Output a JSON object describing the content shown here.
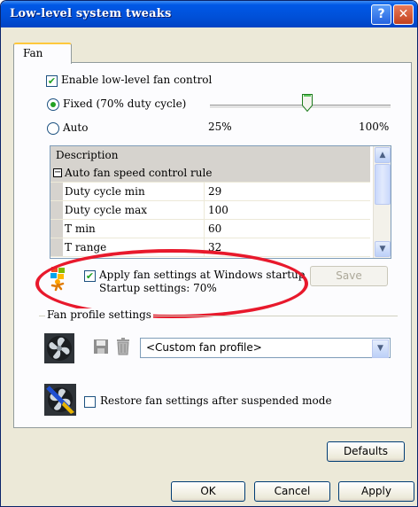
{
  "window": {
    "title": "Low-level system tweaks",
    "help_glyph": "?",
    "close_glyph": "✕"
  },
  "tabs": [
    {
      "label": "Fan",
      "selected": true
    }
  ],
  "fan_control": {
    "enable_label": "Enable low-level fan control",
    "enable_checked": true,
    "fixed_label": "Fixed (70% duty cycle)",
    "fixed_selected": true,
    "auto_label": "Auto",
    "auto_selected": false,
    "slider_min_label": "25%",
    "slider_max_label": "100%",
    "slider_value_percent": 70
  },
  "property_grid": {
    "header": "Description",
    "category": "Auto fan speed control rule",
    "collapse_glyph": "−",
    "rows": [
      {
        "name": "Duty cycle min",
        "value": "29"
      },
      {
        "name": "Duty cycle max",
        "value": "100"
      },
      {
        "name": "T min",
        "value": "60"
      },
      {
        "name": "T range",
        "value": "32"
      }
    ],
    "scroll_up_glyph": "▲",
    "scroll_down_glyph": "▼"
  },
  "startup": {
    "apply_label": "Apply fan settings at Windows startup",
    "apply_checked": true,
    "settings_text": "Startup settings: 70%",
    "save_label": "Save"
  },
  "fan_profile": {
    "group_label": "Fan profile settings",
    "selected_profile": "<Custom fan profile>",
    "dropdown_glyph": "▼"
  },
  "restore": {
    "label": "Restore fan settings after suspended mode",
    "checked": false
  },
  "buttons": {
    "defaults": "Defaults",
    "ok": "OK",
    "cancel": "Cancel",
    "apply": "Apply"
  },
  "colors": {
    "titlebar": "#0050d8",
    "highlight": "#e8192c",
    "check": "#21a121"
  }
}
